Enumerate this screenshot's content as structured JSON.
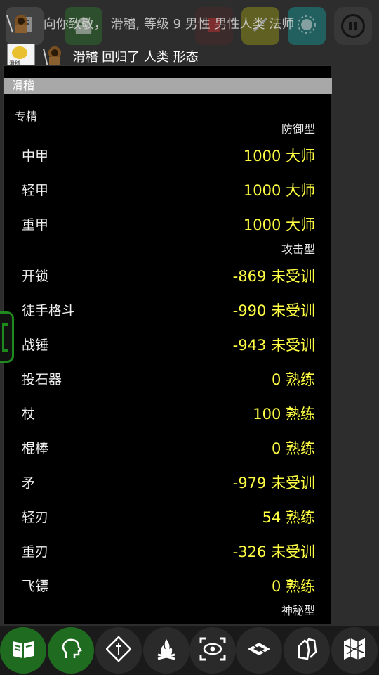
{
  "log": {
    "line1": "向你致敬， 滑稽, 等级 9 男性 男性人类 法师",
    "line2": "滑稽 回归了 人类 形态",
    "image_caption": "滑稽"
  },
  "panel": {
    "title": "滑稽",
    "section": "专精"
  },
  "groups": [
    {
      "name": "防御型",
      "skills": [
        {
          "name": "中甲",
          "value": "1000 大师"
        },
        {
          "name": "轻甲",
          "value": "1000 大师"
        },
        {
          "name": "重甲",
          "value": "1000 大师"
        }
      ]
    },
    {
      "name": "攻击型",
      "skills": [
        {
          "name": "开锁",
          "value": "-869 未受训"
        },
        {
          "name": "徒手格斗",
          "value": "-990 未受训"
        },
        {
          "name": "战锤",
          "value": "-943 未受训"
        },
        {
          "name": "投石器",
          "value": "0 熟练"
        },
        {
          "name": "杖",
          "value": "100 熟练"
        },
        {
          "name": "棍棒",
          "value": "0 熟练"
        },
        {
          "name": "矛",
          "value": "-979 未受训"
        },
        {
          "name": "轻刃",
          "value": "54 熟练"
        },
        {
          "name": "重刃",
          "value": "-326 未受训"
        },
        {
          "name": "飞镖",
          "value": "0 熟练"
        }
      ]
    },
    {
      "name": "神秘型",
      "skills": []
    }
  ],
  "top_toolbar": {
    "icons": [
      "journal-icon",
      "ghost-icon",
      "scroll-icon",
      "wand-icon",
      "burst-icon",
      "pause-icon"
    ]
  },
  "bottom_toolbar": {
    "icons": [
      "book-icon",
      "head-icon",
      "compass-icon",
      "campfire-icon",
      "eye-target-icon",
      "map-tile-icon",
      "gloves-icon",
      "map-icon"
    ]
  },
  "colors": {
    "value": "#ffff44",
    "accent_green": "#1f6b1f",
    "panel_bg": "#000000",
    "title_bar": "#a8a8a8"
  }
}
